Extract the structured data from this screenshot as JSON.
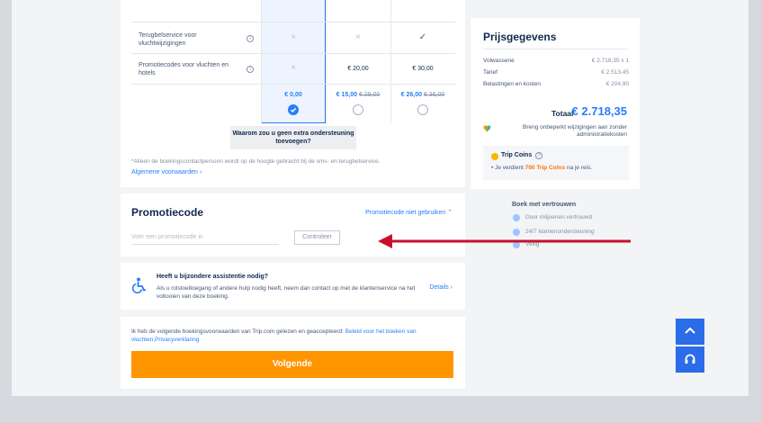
{
  "table": {
    "rows": [
      {
        "label": "Terugbelservice voor vluchtwijzigingen",
        "cols": [
          "×",
          "×",
          "✓"
        ]
      },
      {
        "label": "Promotiecodes voor vluchten en hotels",
        "cols": [
          "×",
          "€ 20,00",
          "€ 30,00"
        ]
      }
    ],
    "prices": [
      {
        "price": "€ 0,00",
        "old": ""
      },
      {
        "price": "€ 15,00",
        "old": "€ 29,00"
      },
      {
        "price": "€ 26,00",
        "old": "€ 36,00"
      }
    ],
    "why_button": "Waarom zou u geen extra ondersteuning toevoegen?",
    "note": "*Alleen de boekingscontactpersoon wordt op de hoogte gebracht bij de sms- en terugbelservice.",
    "terms_link": "Algemene voorwaarden"
  },
  "promo": {
    "title": "Promotiecode",
    "toggle": "Promotiecode niet gebruiken",
    "placeholder": "Voer een promotiecode in",
    "button": "Controleer"
  },
  "assist": {
    "title": "Heeft u bijzondere assistentie nodig?",
    "body": "Als u rolstoeltoegang of andere hulp nodig heeft, neem dan contact op met de klantenservice na het voltooien van deze boeking.",
    "details": "Details"
  },
  "confirm": {
    "text": "Ik heb de volgende boekingsvoorwaarden van Trip.com gelezen en geaccepteerd:",
    "links": "Beleid voor het boeken van vluchten,Privacyverklaring",
    "button": "Volgende"
  },
  "summary": {
    "title": "Prijsgegevens",
    "lines": [
      {
        "label": "Volwassene",
        "value": "€ 2.718,35 x 1"
      },
      {
        "label": "Tarief",
        "value": "€ 2.513,45"
      },
      {
        "label": "Belastingen en kosten",
        "value": "€ 204,90"
      }
    ],
    "total_label": "Totaal",
    "total_value": "€ 2.718,35",
    "flex_text": "Breng onbeperkt wijzigingen aan zonder administratiekosten",
    "coins_title": "Trip Coins",
    "coins_prefix": "Je verdient",
    "coins_amount": "700 Trip Coins",
    "coins_suffix": "na je reis."
  },
  "trust": {
    "title": "Boek met vertrouwen",
    "items": [
      "Door miljoenen vertrouwd",
      "24/7 klantenondersteuning",
      "Veilig"
    ]
  },
  "colors": {
    "accent": "#287dfa",
    "cta": "#ff9500",
    "arrow": "#c8102e"
  }
}
